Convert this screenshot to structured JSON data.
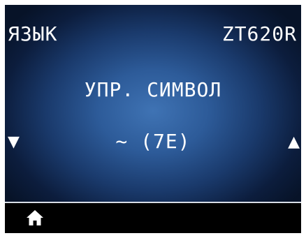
{
  "header": {
    "menu_title": "ЯЗЫК",
    "printer_model": "ZT620R"
  },
  "menu": {
    "label": "УПР. СИМВОЛ",
    "value": "~ (7E)",
    "prev_glyph": "▼",
    "next_glyph": "▲"
  },
  "footer": {
    "home_icon": "home-icon"
  },
  "colors": {
    "panel_center": "#3f73b4",
    "panel_edge": "#071328",
    "frame": "#000000",
    "text": "#ffffff"
  }
}
